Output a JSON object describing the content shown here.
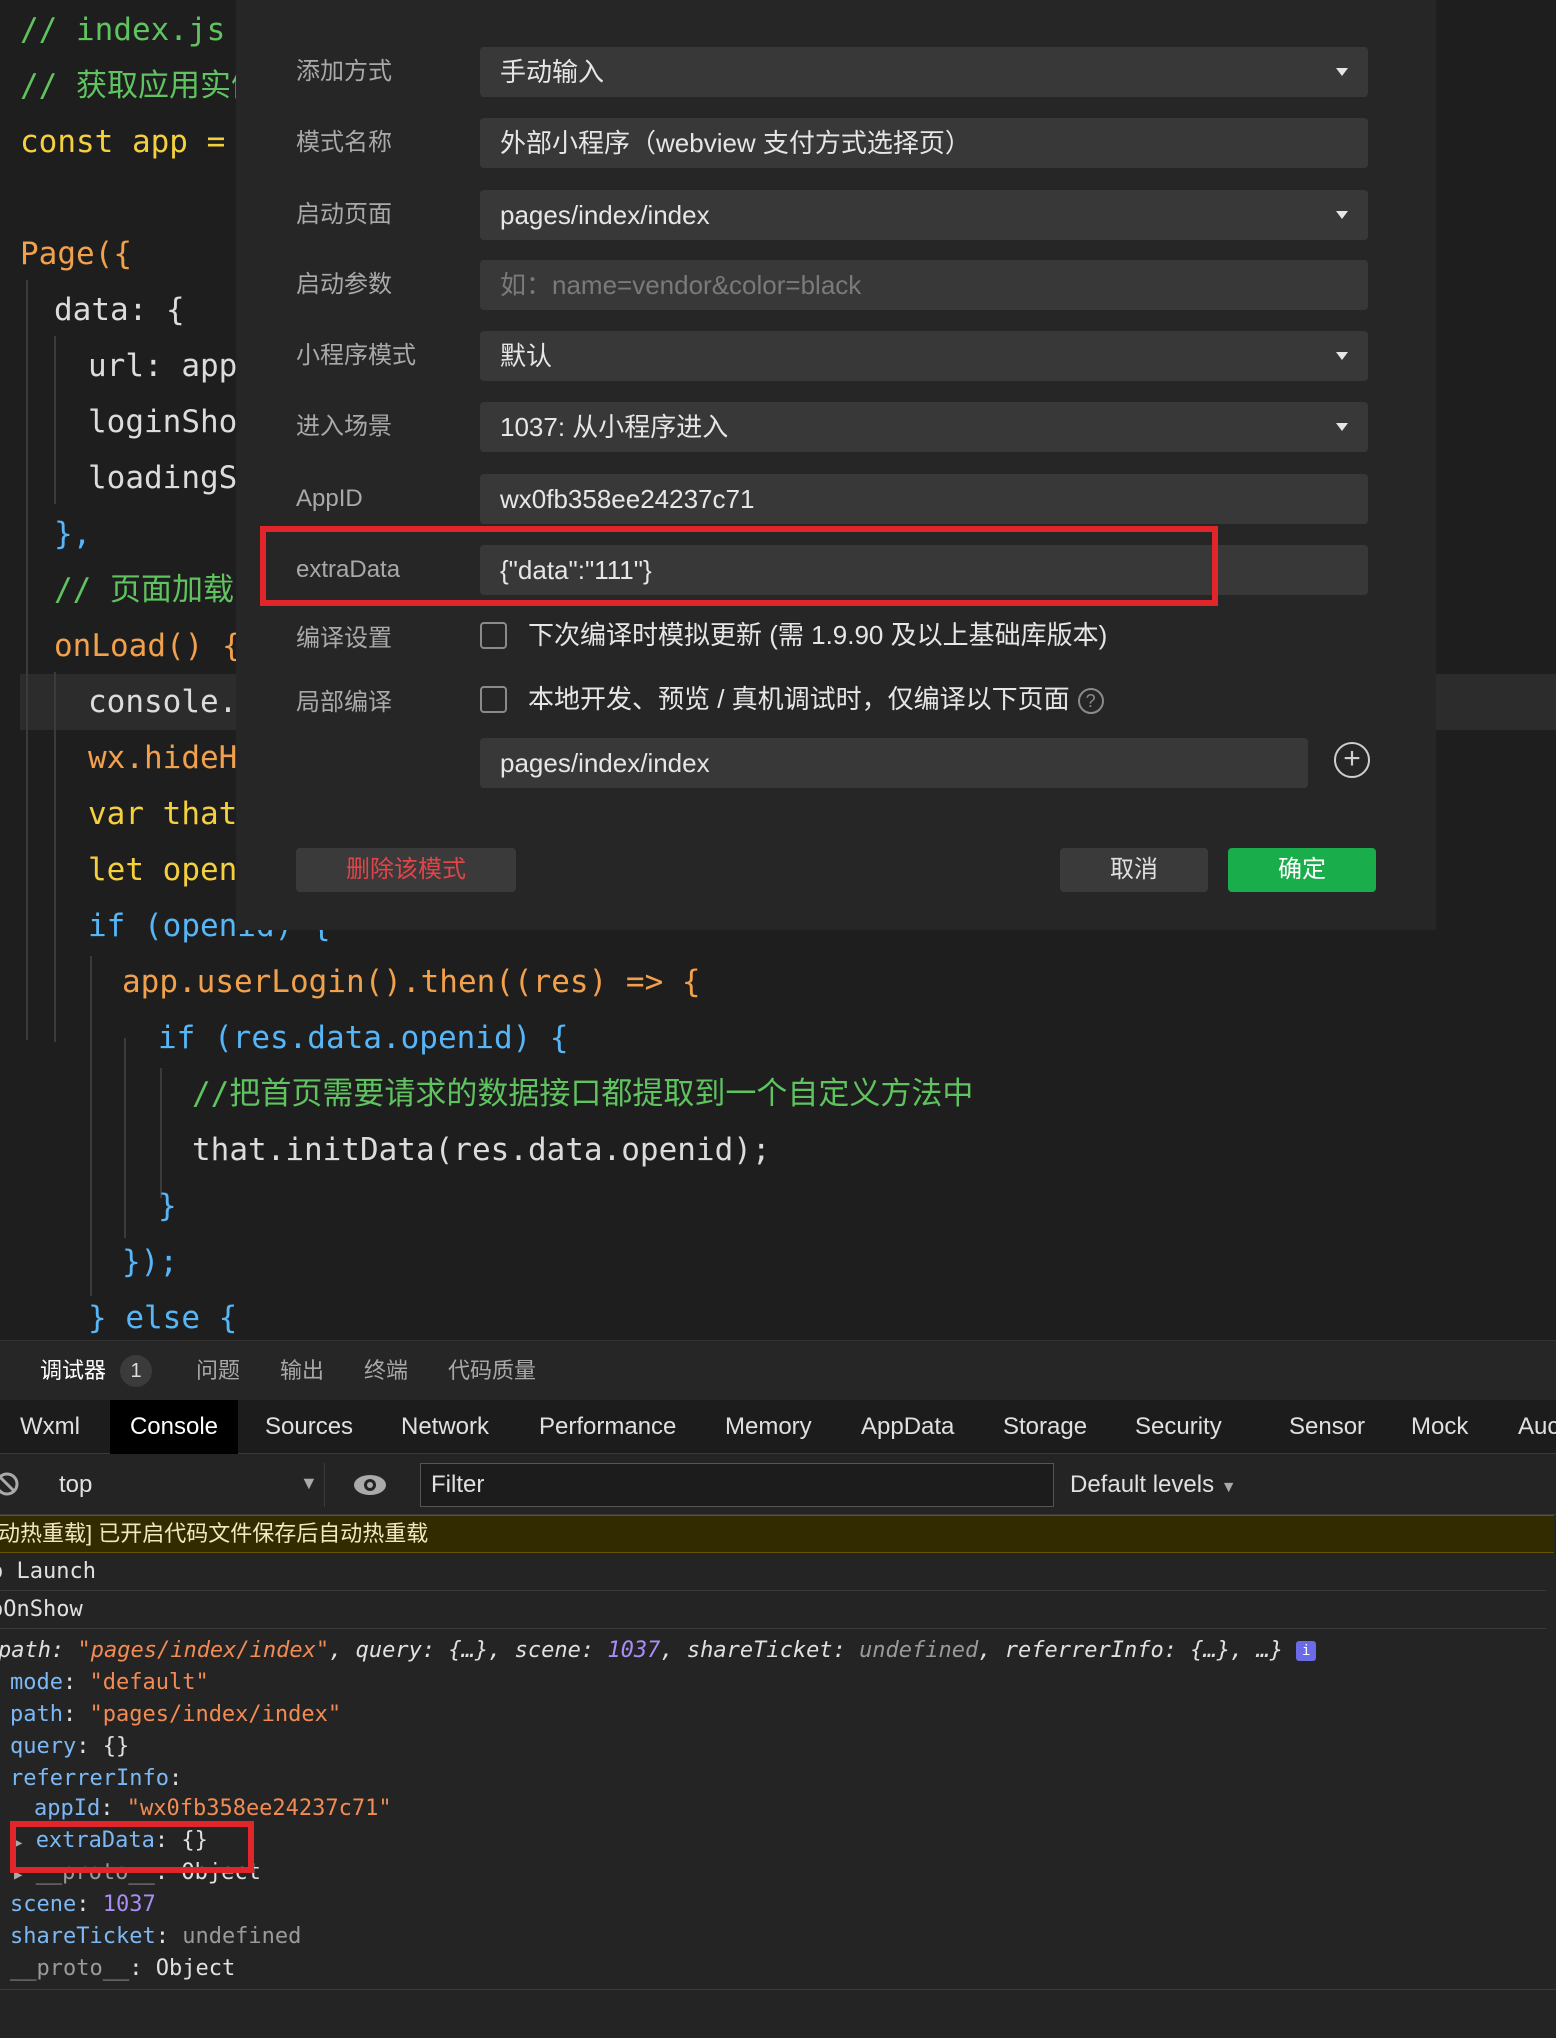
{
  "editor": {
    "lines": [
      {
        "t": "// index.js"
      },
      {
        "t": "// 获取应用实例"
      },
      {
        "t": "const app = g"
      },
      {
        "t": ""
      },
      {
        "t": "Page({"
      },
      {
        "t": "data: {"
      },
      {
        "t": "url: app."
      },
      {
        "t": "loginShow"
      },
      {
        "t": "loadingSh"
      },
      {
        "t": "},"
      },
      {
        "t": "// 页面加载时"
      },
      {
        "t": "onLoad() {"
      },
      {
        "t": "console.l"
      },
      {
        "t": "wx.hideHo"
      },
      {
        "t": "var that"
      },
      {
        "t": "let openi"
      },
      {
        "t": "if (openid) {"
      },
      {
        "t": "app.userLogin().then((res) => {"
      },
      {
        "t": "if (res.data.openid) {"
      },
      {
        "t": "//把首页需要请求的数据接口都提取到一个自定义方法中"
      },
      {
        "t": "that.initData(res.data.openid);"
      },
      {
        "t": "}"
      },
      {
        "t": "});"
      },
      {
        "t": "} else {"
      }
    ]
  },
  "dialog": {
    "fields": {
      "add_method": {
        "label": "添加方式",
        "value": "手动输入"
      },
      "mode_name": {
        "label": "模式名称",
        "value": "外部小程序（webview 支付方式选择页）"
      },
      "start_page": {
        "label": "启动页面",
        "value": "pages/index/index"
      },
      "start_params": {
        "label": "启动参数",
        "placeholder": "如：name=vendor&color=black"
      },
      "mini_mode": {
        "label": "小程序模式",
        "value": "默认"
      },
      "scene": {
        "label": "进入场景",
        "value": "1037: 从小程序进入"
      },
      "appid": {
        "label": "AppID",
        "value": "wx0fb358ee24237c71"
      },
      "extra_data": {
        "label": "extraData",
        "value": "{\"data\":\"111\"}"
      }
    },
    "compile_settings": {
      "label": "编译设置",
      "checkbox_text": "下次编译时模拟更新 (需 1.9.90 及以上基础库版本)",
      "checked": false
    },
    "partial_compile": {
      "label": "局部编译",
      "checkbox_text": "本地开发、预览 / 真机调试时，仅编译以下页面",
      "checked": false,
      "page": "pages/index/index"
    },
    "buttons": {
      "delete": "删除该模式",
      "cancel": "取消",
      "confirm": "确定"
    },
    "colors": {
      "confirm": "#1aad4b",
      "delete_text": "#e0454a",
      "highlight": "#e0252b"
    }
  },
  "devtools": {
    "panel_tabs": [
      {
        "label": "调试器",
        "badge": "1"
      },
      {
        "label": "问题"
      },
      {
        "label": "输出"
      },
      {
        "label": "终端"
      },
      {
        "label": "代码质量"
      }
    ],
    "tool_tabs": [
      "Wxml",
      "Console",
      "Sources",
      "Network",
      "Performance",
      "Memory",
      "AppData",
      "Storage",
      "Security",
      "Sensor",
      "Mock",
      "Auc"
    ],
    "active_tool_tab": "Console",
    "context": "top",
    "filter_placeholder": "Filter",
    "levels": "Default levels",
    "console": {
      "warn": "动热重载] 已开启代码文件保存后自动热重载",
      "launch": "Launch",
      "onshow": "OnShow",
      "summary": {
        "path_key": "path",
        "path_val": "\"pages/index/index\"",
        "query_key": "query",
        "query_val": "{…}",
        "scene_key": "scene",
        "scene_val": "1037",
        "share_key": "shareTicket",
        "share_val": "undefined",
        "ref_key": "referrerInfo",
        "ref_val": "{…}",
        "rest": "…}"
      },
      "mode_key": "mode",
      "mode_val": "\"default\"",
      "path_key": "path",
      "path_val": "\"pages/index/index\"",
      "query_key": "query",
      "query_val": "{}",
      "ref_key": "referrerInfo",
      "appid_key": "appId",
      "appid_val": "\"wx0fb358ee24237c71\"",
      "extra_key": "extraData",
      "extra_val": "{}",
      "proto1_key": "__proto__",
      "proto1_val": "Object",
      "scene_key": "scene",
      "scene_val": "1037",
      "share_key": "shareTicket",
      "share_val": "undefined",
      "proto2_key": "__proto__",
      "proto2_val": "Object"
    }
  }
}
